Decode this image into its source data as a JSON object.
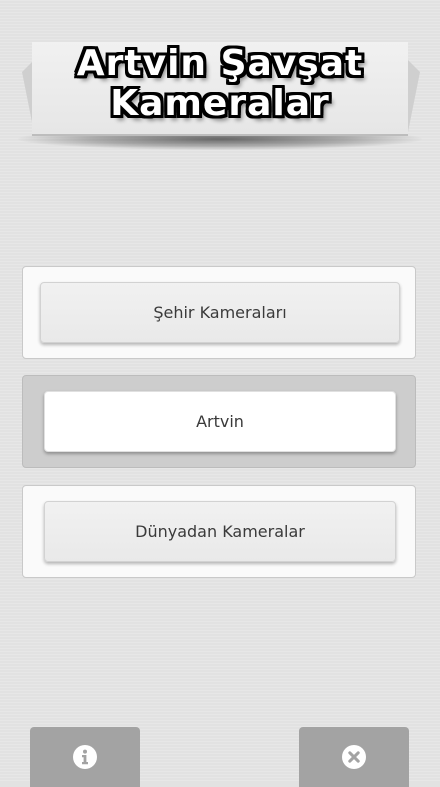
{
  "header": {
    "title_line1": "Artvin Şavşat",
    "title_line2": "Kameralar"
  },
  "menu": {
    "items": [
      {
        "label": "Şehir Kameraları",
        "selected": false
      },
      {
        "label": "Artvin",
        "selected": true
      },
      {
        "label": "Dünyadan Kameralar",
        "selected": false
      }
    ]
  },
  "bottom_bar": {
    "left_icon": "info-icon",
    "right_icon": "close-icon"
  },
  "colors": {
    "background": "#e2e2e2",
    "card": "#fafafa",
    "selected_card": "#cdcdcd",
    "bottom_button": "#a3a3a3",
    "title_text": "#ffffff",
    "title_outline": "#000000"
  }
}
